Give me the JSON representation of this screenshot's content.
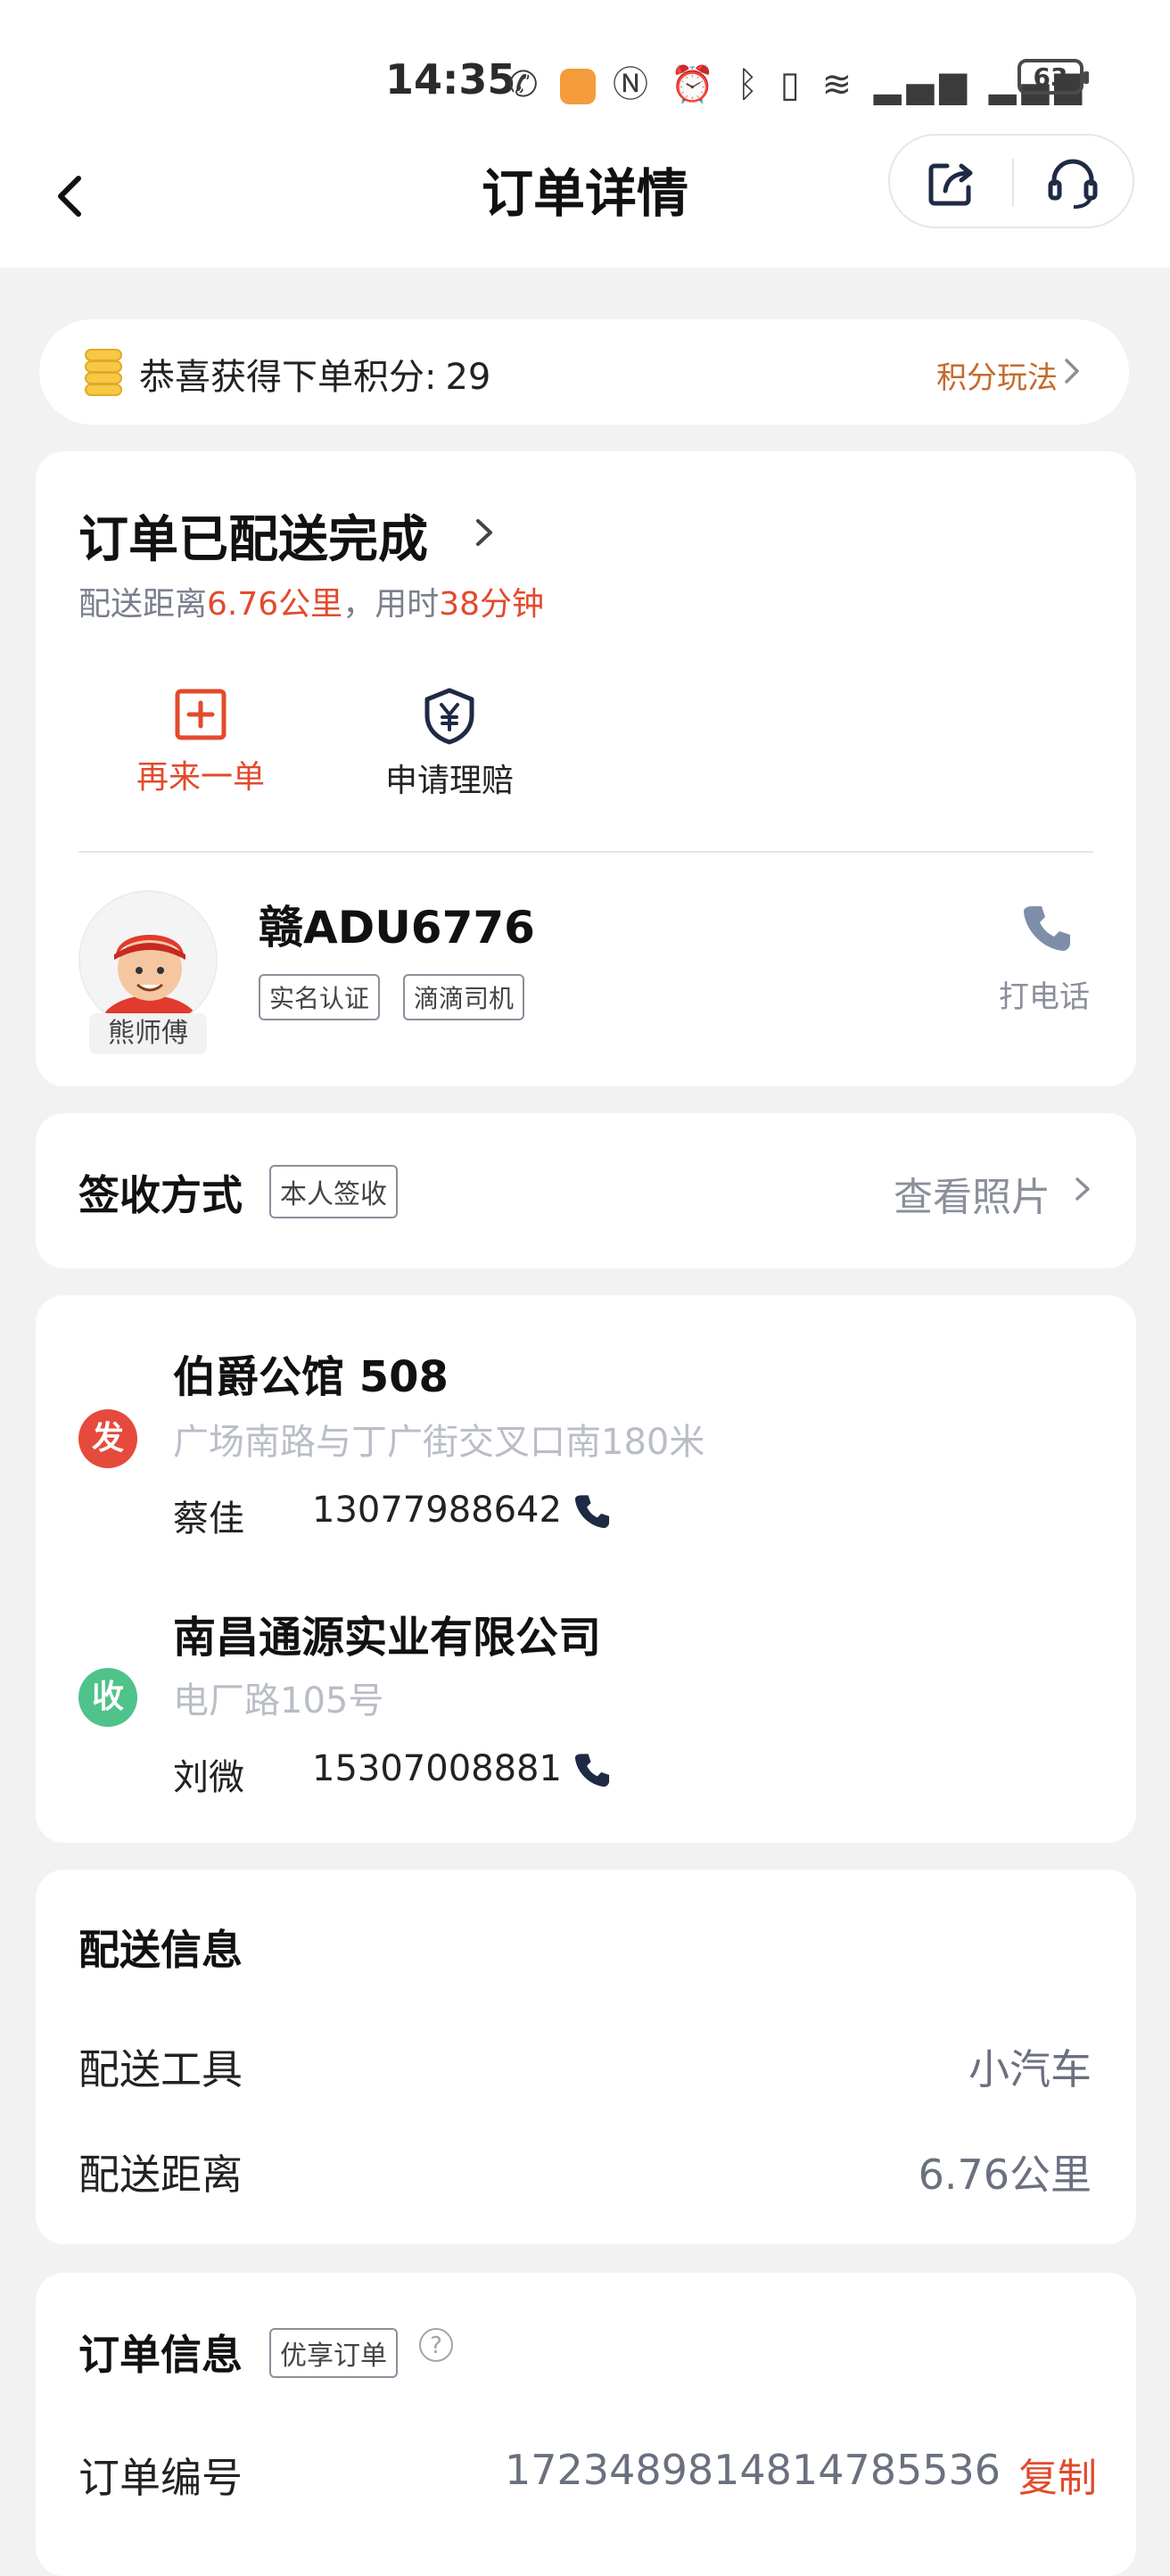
{
  "status_bar": {
    "time": "14:35",
    "icons": [
      "missed-call-icon",
      "app-badge-icon",
      "nfc-icon",
      "alarm-icon",
      "bluetooth-icon",
      "vibrate-icon",
      "wifi-icon",
      "signal-4g-icon",
      "signal-4g-icon"
    ],
    "battery": "63"
  },
  "header": {
    "title": "订单详情",
    "back_icon": "chevron-left-icon",
    "share_icon": "share-icon",
    "service_icon": "headset-icon"
  },
  "points_banner": {
    "text": "恭喜获得下单积分:",
    "points": "29",
    "link": "积分玩法"
  },
  "order_status": {
    "title": "订单已配送完成",
    "distance_prefix": "配送距离",
    "distance": "6.76公里",
    "time_prefix": "，用时",
    "duration": "38分钟",
    "actions": [
      {
        "label": "再来一单",
        "icon": "reorder-plus-icon"
      },
      {
        "label": "申请理赔",
        "icon": "shield-yuan-icon"
      }
    ]
  },
  "driver": {
    "name": "熊师傅",
    "plate": "赣ADU6776",
    "tags": [
      "实名认证",
      "滴滴司机"
    ],
    "call_label": "打电话"
  },
  "signing": {
    "label": "签收方式",
    "tag": "本人签收",
    "link": "查看照片"
  },
  "addresses": [
    {
      "badge": "发",
      "name": "伯爵公馆 508",
      "detail": "广场南路与丁广街交叉口南180米",
      "contact": "蔡佳",
      "phone": "13077988642"
    },
    {
      "badge": "收",
      "name": "南昌通源实业有限公司",
      "detail": "电厂路105号",
      "contact": "刘微",
      "phone": "15307008881"
    }
  ],
  "delivery_info": {
    "title": "配送信息",
    "rows": [
      {
        "label": "配送工具",
        "value": "小汽车"
      },
      {
        "label": "配送距离",
        "value": "6.76公里"
      }
    ]
  },
  "order_info": {
    "title": "订单信息",
    "tag": "优享订单",
    "help": "?",
    "rows": [
      {
        "label": "订单编号",
        "value": "1723489814814785536",
        "action": "复制"
      }
    ]
  },
  "colors": {
    "accent_red": "#e24a2c",
    "orange_link": "#c66a2c",
    "green_badge": "#4fc38a",
    "background": "#f2f2f2"
  }
}
